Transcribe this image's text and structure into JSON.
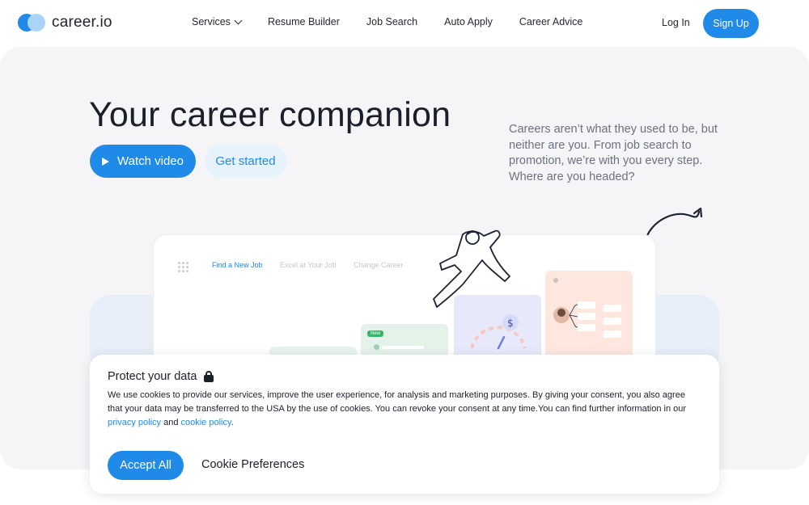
{
  "header": {
    "logo_text": "career.io",
    "nav": [
      {
        "label": "Services",
        "has_dropdown": true
      },
      {
        "label": "Resume Builder"
      },
      {
        "label": "Job Search"
      },
      {
        "label": "Auto Apply"
      },
      {
        "label": "Career Advice"
      }
    ],
    "login_label": "Log In",
    "signup_label": "Sign Up"
  },
  "hero": {
    "title": "Your career companion",
    "description": "Careers aren’t what they used to be, but neither are you. From job search to promotion, we’re with you every step. Where are you headed?",
    "watch_video_label": "Watch video",
    "get_started_label": "Get started",
    "preview": {
      "tabs": [
        "Find a New Job",
        "Excel at Your Job",
        "Change Career"
      ],
      "new_tag": "New"
    }
  },
  "cookie": {
    "title": "Protect your data",
    "text_before_links": "We use cookies to provide our services, improve the user experience, for analysis and marketing purposes. By giving your consent, you also agree that your data may be transferred to the USA by the use of cookies. You can revoke your consent at any time.You can find further information in our ",
    "privacy_link": "privacy policy",
    "and_text": " and ",
    "cookie_link": "cookie policy",
    "end_text": ".",
    "accept_label": "Accept All",
    "preferences_label": "Cookie Preferences"
  },
  "colors": {
    "accent": "#1f8ae8",
    "accent_light": "#e6f2fc",
    "hero_bg": "#f5f5f7",
    "text_dark": "#1b1f2a",
    "text_muted": "#6b7180"
  },
  "icons": [
    "logo-mark-icon",
    "chevron-down-icon",
    "play-icon",
    "lock-icon",
    "grid-dots-icon",
    "dollar-icon"
  ]
}
